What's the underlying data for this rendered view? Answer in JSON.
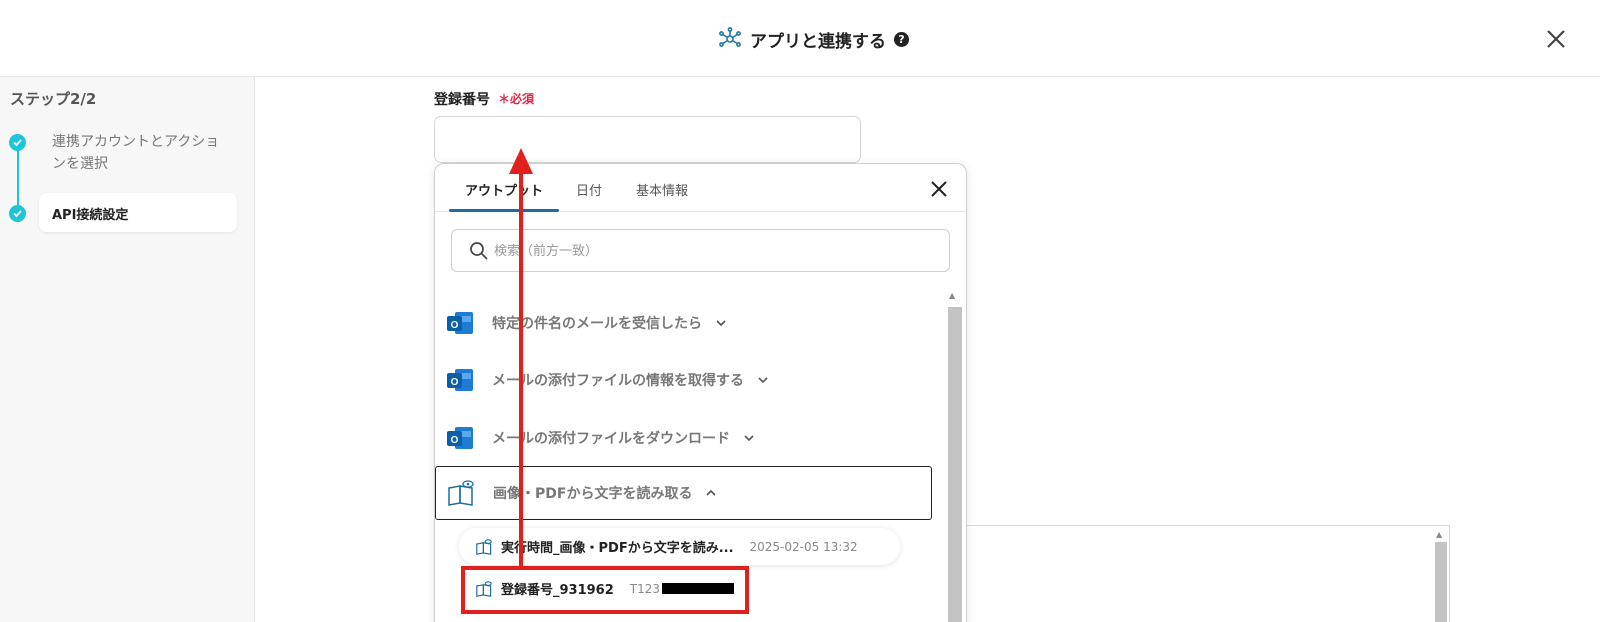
{
  "header": {
    "title": "アプリと連携する",
    "help": "?"
  },
  "sidebar": {
    "heading": "ステップ2/2",
    "steps": [
      {
        "label": "連携アカウントとアクションを選択",
        "done": true
      },
      {
        "label": "API接続設定",
        "done": true,
        "current": true
      }
    ]
  },
  "field": {
    "label": "登録番号",
    "required": "＊必須",
    "value": ""
  },
  "popup": {
    "tabs": [
      {
        "label": "アウトプット",
        "active": true
      },
      {
        "label": "日付",
        "active": false
      },
      {
        "label": "基本情報",
        "active": false
      }
    ],
    "search": {
      "placeholder": "検索（前方一致）",
      "value": ""
    },
    "groups": [
      {
        "label": "特定の件名のメールを受信したら",
        "icon": "outlook-icon",
        "expanded": false
      },
      {
        "label": "メールの添付ファイルの情報を取得する",
        "icon": "outlook-icon",
        "expanded": false
      },
      {
        "label": "メールの添付ファイルをダウンロード",
        "icon": "outlook-icon",
        "expanded": false
      },
      {
        "label": "画像・PDFから文字を読み取る",
        "icon": "book-ocr-icon",
        "expanded": true
      }
    ],
    "items": [
      {
        "name": "実行時間_画像・PDFから文字を読み...",
        "value": "2025-02-05 13:32"
      },
      {
        "name": "登録番号_931962",
        "value": "T123"
      }
    ]
  },
  "colors": {
    "accent": "#1ec5d8",
    "required": "#e0294a",
    "annotation": "#e0201d",
    "tab_underline": "#1d6ea0"
  }
}
